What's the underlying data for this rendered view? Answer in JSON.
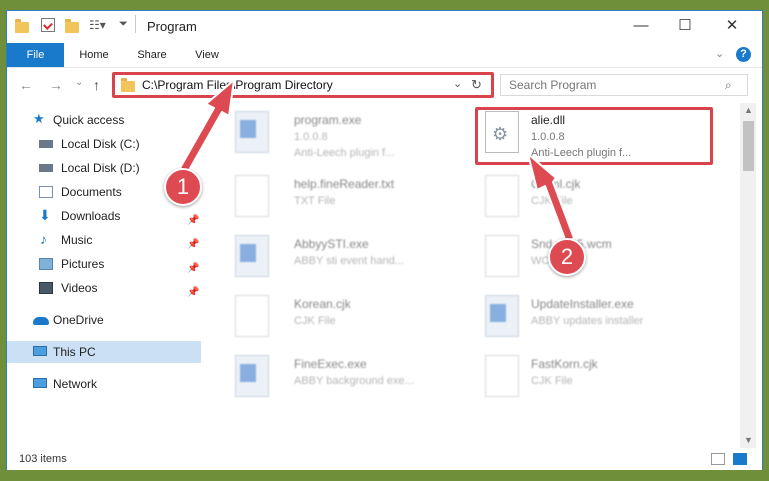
{
  "window": {
    "title": "Program",
    "minimize": "—",
    "maximize": "☐",
    "close": "✕"
  },
  "ribbon": {
    "tabs": [
      "File",
      "Home",
      "Share",
      "View"
    ],
    "help": "?"
  },
  "address": {
    "path": "C:\\Program Files\\Program Directory",
    "search_placeholder": "Search Program"
  },
  "sidebar": {
    "items": [
      {
        "label": "Quick access"
      },
      {
        "label": "Local Disk (C:)"
      },
      {
        "label": "Local Disk (D:)"
      },
      {
        "label": "Documents"
      },
      {
        "label": "Downloads"
      },
      {
        "label": "Music"
      },
      {
        "label": "Pictures"
      },
      {
        "label": "Videos"
      },
      {
        "label": "OneDrive"
      },
      {
        "label": "This PC"
      },
      {
        "label": "Network"
      }
    ]
  },
  "files": [
    {
      "name": "program.exe",
      "line2": "1.0.0.8",
      "line3": "Anti-Leech plugin f..."
    },
    {
      "name": "alie.dll",
      "line2": "1.0.0.8",
      "line3": "Anti-Leech plugin f..."
    },
    {
      "name": "help.fineReader.txt",
      "line2": "TXT File",
      "line3": ""
    },
    {
      "name": "Chtml.cjk",
      "line2": "CJK File",
      "line3": ""
    },
    {
      "name": "AbbyySTI.exe",
      "line2": "ABBY sti event hand...",
      "line3": ""
    },
    {
      "name": "Snd...P15.wcm",
      "line2": "WCM File",
      "line3": ""
    },
    {
      "name": "Korean.cjk",
      "line2": "CJK File",
      "line3": ""
    },
    {
      "name": "UpdateInstaller.exe",
      "line2": "ABBY updates installer",
      "line3": ""
    },
    {
      "name": "FineExec.exe",
      "line2": "ABBY background exe...",
      "line3": ""
    },
    {
      "name": "FastKorn.cjk",
      "line2": "CJK File",
      "line3": ""
    }
  ],
  "status": {
    "items_count": "103 items"
  },
  "annotations": {
    "step1": "1",
    "step2": "2"
  },
  "colors": {
    "accent": "#1979ca",
    "annotation_red": "#de4a51",
    "selection": "#cce0f5"
  }
}
